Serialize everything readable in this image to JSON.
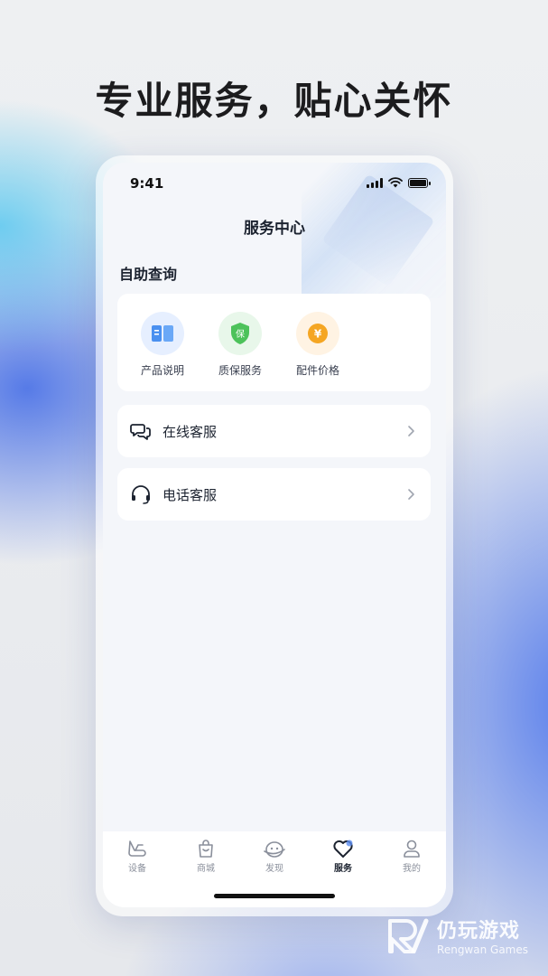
{
  "headline": "专业服务，贴心关怀",
  "status": {
    "time": "9:41"
  },
  "header": {
    "title": "服务中心"
  },
  "self_service": {
    "title": "自助查询",
    "items": [
      {
        "label": "产品说明",
        "icon": "manual-book-icon",
        "color": "#4a90f0",
        "glyph": "≡"
      },
      {
        "label": "质保服务",
        "icon": "warranty-shield-icon",
        "color": "#4cc25a",
        "glyph": "保"
      },
      {
        "label": "配件价格",
        "icon": "yuan-price-icon",
        "color": "#f5a623",
        "glyph": "¥"
      }
    ]
  },
  "support": {
    "online": {
      "label": "在线客服",
      "icon": "chat-bubbles-icon"
    },
    "phone": {
      "label": "电话客服",
      "icon": "headset-icon"
    }
  },
  "tabbar": {
    "tabs": [
      {
        "label": "设备",
        "icon": "device-icon",
        "active": false
      },
      {
        "label": "商城",
        "icon": "shopping-bag-icon",
        "active": false
      },
      {
        "label": "发现",
        "icon": "discover-icon",
        "active": false
      },
      {
        "label": "服务",
        "icon": "heart-service-icon",
        "active": true
      },
      {
        "label": "我的",
        "icon": "user-icon",
        "active": false
      }
    ]
  },
  "watermark": {
    "cn": "仍玩游戏",
    "en": "Rengwan Games"
  },
  "colors": {
    "accent": "#1c2330",
    "inactive": "#8a8f9b",
    "bg_blue": "#5a80e6"
  }
}
